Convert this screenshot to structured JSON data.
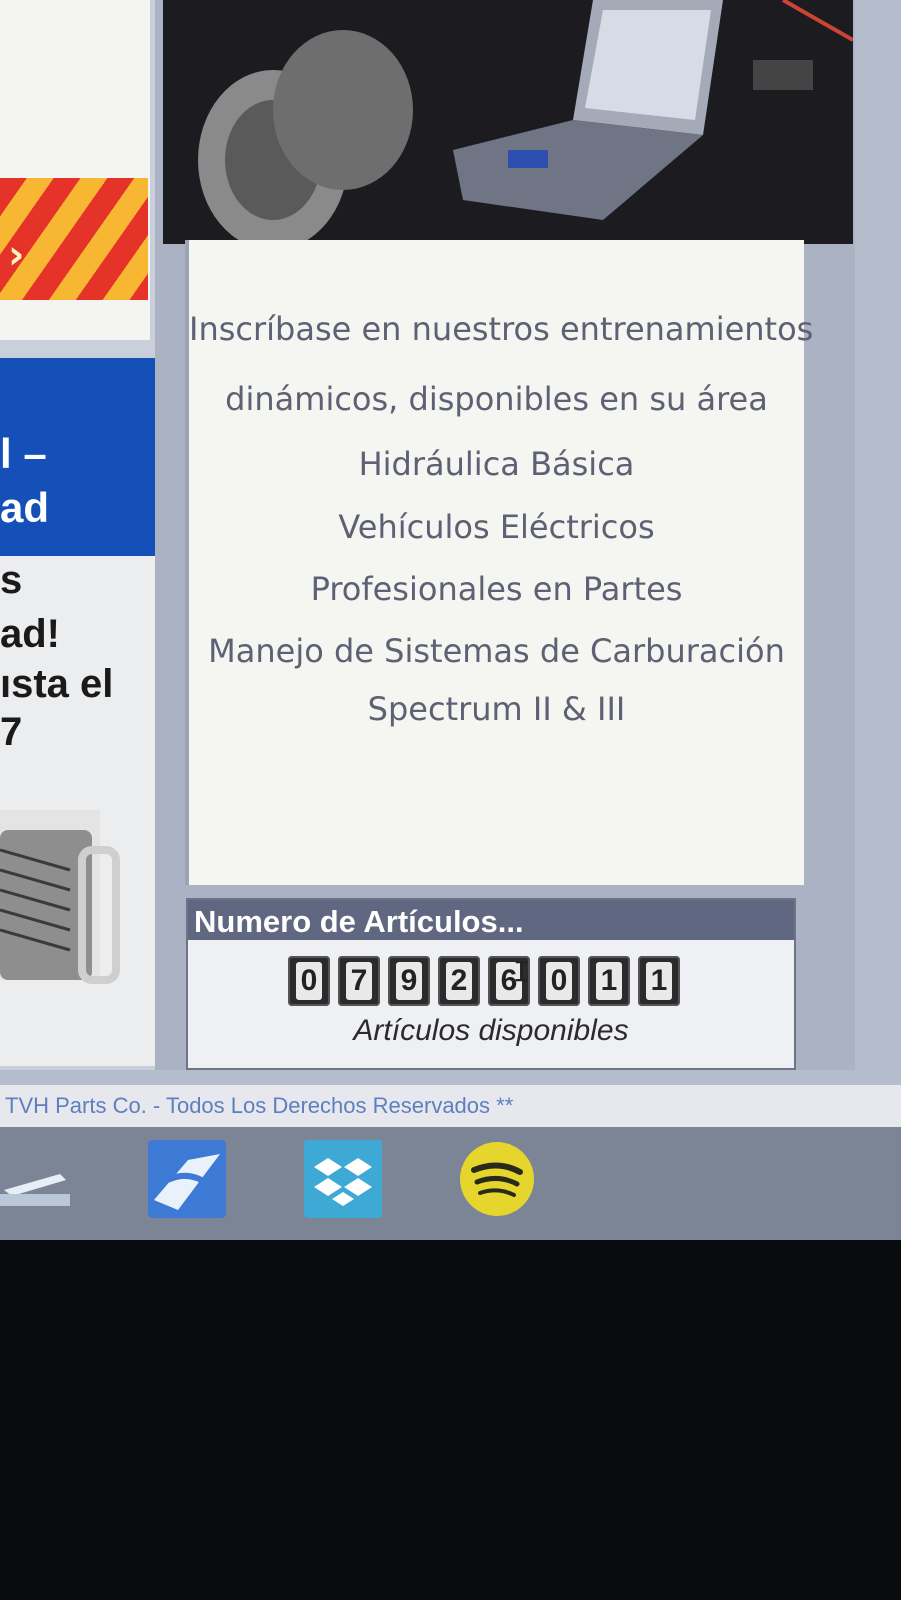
{
  "training": {
    "intro_line1": "Inscríbase en nuestros entrenamientos",
    "intro_line2": "dinámicos, disponibles en su área",
    "courses": [
      "Hidráulica Básica",
      "Vehículos Eléctricos",
      "Profesionales en Partes",
      "Manejo de Sistemas de Carburación",
      "Spectrum II & III"
    ]
  },
  "left_promo": {
    "blue_lines": [
      "l –",
      "ad"
    ],
    "white_lines": [
      "s",
      "ad!",
      "ısta el",
      "7"
    ]
  },
  "counter": {
    "title": "Numero de Artículos...",
    "digits": [
      "0",
      "7",
      "9",
      "2",
      "6",
      "0",
      "1",
      "1"
    ],
    "caption": "Artículos disponibles"
  },
  "footer": {
    "text": "TVH Parts Co. - Todos Los Derechos Reservados **"
  },
  "taskbar": {
    "icons": [
      "scanner-icon",
      "mail-icon",
      "dropbox-icon",
      "spotify-icon"
    ]
  },
  "colors": {
    "promo_blue": "#1450b8",
    "counter_header": "#5f6781",
    "footer_link": "#5e7fbf",
    "spotify": "#e5d52d",
    "dropbox": "#3fa9d6"
  }
}
